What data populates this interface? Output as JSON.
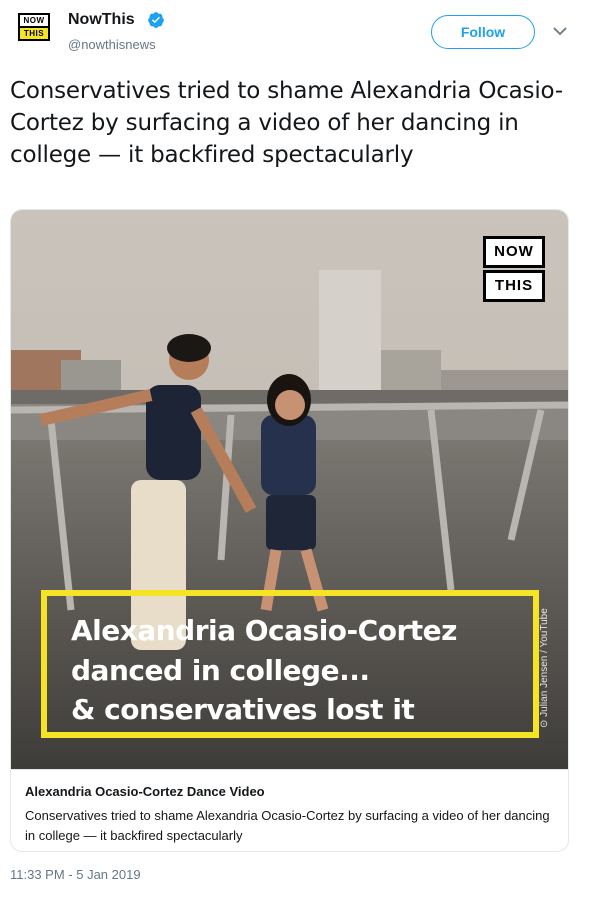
{
  "author": {
    "name": "NowThis",
    "handle": "@nowthisnews",
    "logo_top": "NOW",
    "logo_bottom": "THIS",
    "follow_label": "Follow"
  },
  "tweet": {
    "text": "Conservatives tried to shame Alexandria Ocasio-Cortez by surfacing a video of her dancing in college — it backfired spectacularly",
    "timestamp": "11:33 PM - 5 Jan 2019"
  },
  "card": {
    "overlay_logo_top": "NOW",
    "overlay_logo_bottom": "THIS",
    "caption_lines": [
      "Alexandria Ocasio-Cortez",
      "danced in college...",
      "& conservatives lost it"
    ],
    "credit": "Julian Jensen / YouTube",
    "title": "Alexandria Ocasio-Cortez Dance Video",
    "description": "Conservatives tried to shame Alexandria Ocasio-Cortez by surfacing a video of her dancing in college — it backfired spectacularly"
  },
  "colors": {
    "accent": "#1da1f2",
    "brand_yellow": "#f4e425",
    "muted": "#657786"
  },
  "icons": {
    "verified": "verified-badge-icon",
    "chevron": "chevron-down-icon",
    "copyright": "copyright-icon"
  }
}
